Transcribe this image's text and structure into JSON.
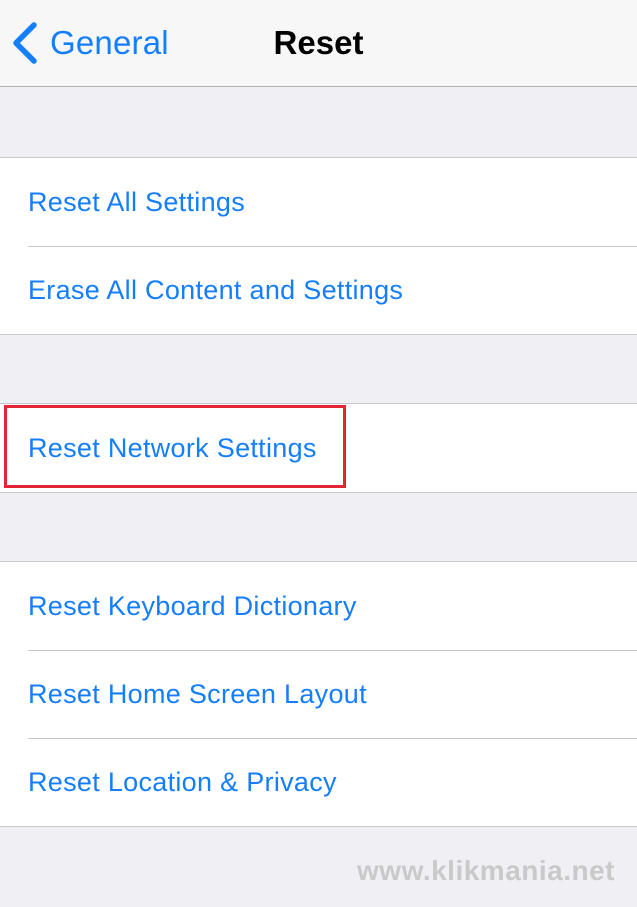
{
  "navbar": {
    "back_label": "General",
    "title": "Reset"
  },
  "groups": [
    {
      "items": [
        {
          "label": "Reset All Settings"
        },
        {
          "label": "Erase All Content and Settings"
        }
      ]
    },
    {
      "items": [
        {
          "label": "Reset Network Settings"
        }
      ]
    },
    {
      "items": [
        {
          "label": "Reset Keyboard Dictionary"
        },
        {
          "label": "Reset Home Screen Layout"
        },
        {
          "label": "Reset Location & Privacy"
        }
      ]
    }
  ],
  "highlight": {
    "target": "Reset Network Settings",
    "color": "#e32636"
  },
  "watermark": "www.klikmania.net",
  "colors": {
    "accent": "#157efb",
    "background": "#efeff4",
    "cell": "#ffffff",
    "separator": "#c8c7cc"
  }
}
